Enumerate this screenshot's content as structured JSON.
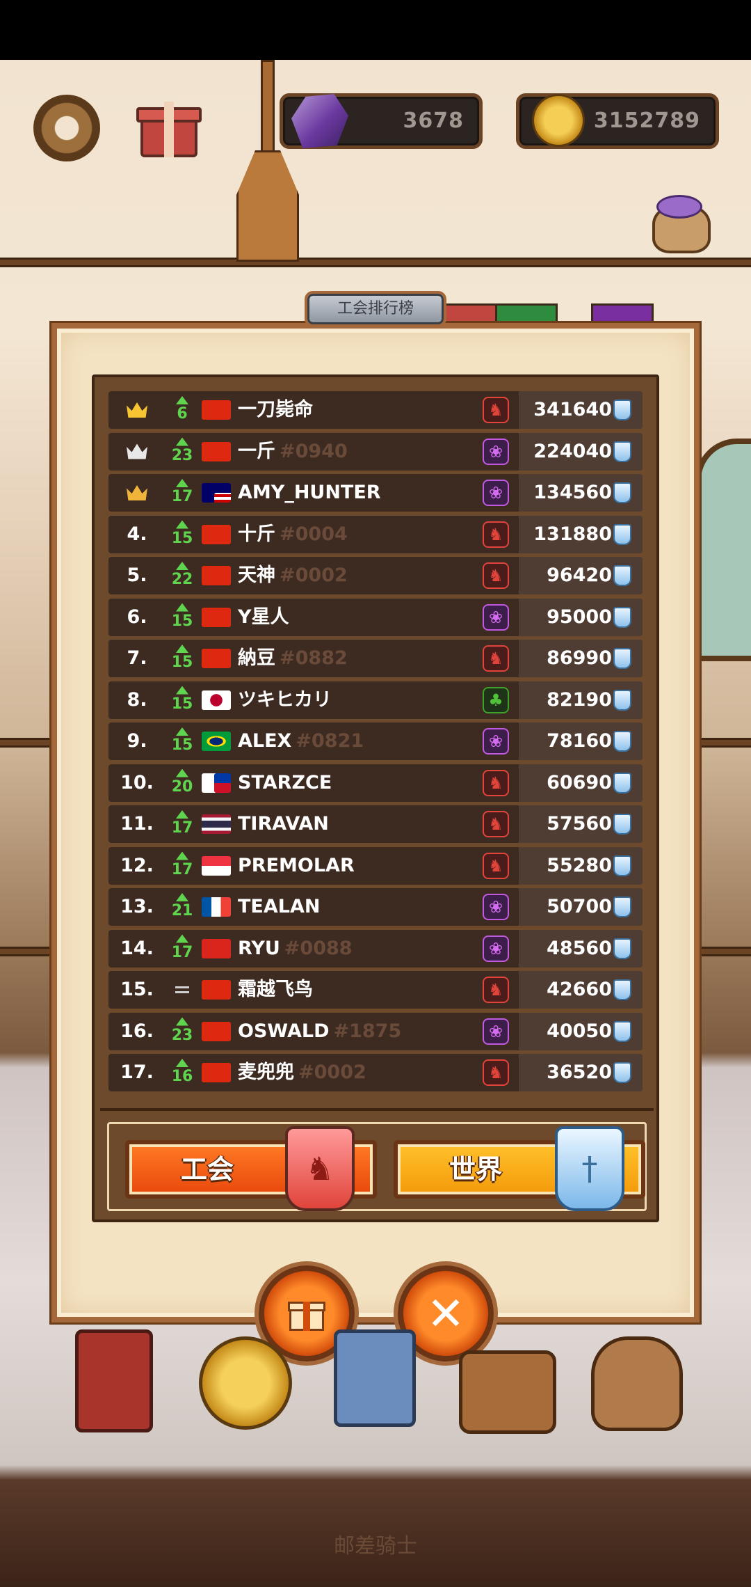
{
  "hud": {
    "gems": "3678",
    "coins": "3152789"
  },
  "panel": {
    "title": "工会排行榜"
  },
  "leaderboard": [
    {
      "rank": "",
      "crown": "gold",
      "level": "6",
      "trend": "up",
      "flag": "cn",
      "name": "一刀毙命",
      "tag": "",
      "guild": "red",
      "score": "341640"
    },
    {
      "rank": "",
      "crown": "silver",
      "level": "23",
      "trend": "up",
      "flag": "cn",
      "name": "一斤",
      "tag": "#0940",
      "guild": "purple",
      "score": "224040"
    },
    {
      "rank": "",
      "crown": "bronze",
      "level": "17",
      "trend": "up",
      "flag": "my",
      "name": "AMY_HUNTER",
      "tag": "",
      "guild": "purple",
      "score": "134560"
    },
    {
      "rank": "4.",
      "crown": "",
      "level": "15",
      "trend": "up",
      "flag": "cn",
      "name": "十斤",
      "tag": "#0004",
      "guild": "red",
      "score": "131880"
    },
    {
      "rank": "5.",
      "crown": "",
      "level": "22",
      "trend": "up",
      "flag": "cn",
      "name": "天神",
      "tag": "#0002",
      "guild": "red",
      "score": "96420"
    },
    {
      "rank": "6.",
      "crown": "",
      "level": "15",
      "trend": "up",
      "flag": "cn",
      "name": "Y星人",
      "tag": "",
      "guild": "purple",
      "score": "95000"
    },
    {
      "rank": "7.",
      "crown": "",
      "level": "15",
      "trend": "up",
      "flag": "cn",
      "name": "納豆",
      "tag": "#0882",
      "guild": "red",
      "score": "86990"
    },
    {
      "rank": "8.",
      "crown": "",
      "level": "15",
      "trend": "up",
      "flag": "jp",
      "name": "ツキヒカリ",
      "tag": "",
      "guild": "green",
      "score": "82190"
    },
    {
      "rank": "9.",
      "crown": "",
      "level": "15",
      "trend": "up",
      "flag": "br",
      "name": "ALEX",
      "tag": "#0821",
      "guild": "purple",
      "score": "78160"
    },
    {
      "rank": "10.",
      "crown": "",
      "level": "20",
      "trend": "up",
      "flag": "ph",
      "name": "STARZCE",
      "tag": "",
      "guild": "red",
      "score": "60690"
    },
    {
      "rank": "11.",
      "crown": "",
      "level": "17",
      "trend": "up",
      "flag": "th",
      "name": "TIRAVAN",
      "tag": "",
      "guild": "red",
      "score": "57560"
    },
    {
      "rank": "12.",
      "crown": "",
      "level": "17",
      "trend": "up",
      "flag": "sg",
      "name": "PREMOLAR",
      "tag": "",
      "guild": "red",
      "score": "55280"
    },
    {
      "rank": "13.",
      "crown": "",
      "level": "21",
      "trend": "up",
      "flag": "fr",
      "name": "TEALAN",
      "tag": "",
      "guild": "purple",
      "score": "50700"
    },
    {
      "rank": "14.",
      "crown": "",
      "level": "17",
      "trend": "up",
      "flag": "vn",
      "name": "RYU",
      "tag": "#0088",
      "guild": "purple",
      "score": "48560"
    },
    {
      "rank": "15.",
      "crown": "",
      "level": "",
      "trend": "same",
      "flag": "cn",
      "name": "霜越飞鸟",
      "tag": "",
      "guild": "red",
      "score": "42660"
    },
    {
      "rank": "16.",
      "crown": "",
      "level": "23",
      "trend": "up",
      "flag": "cn",
      "name": "OSWALD",
      "tag": "#1875",
      "guild": "purple",
      "score": "40050"
    },
    {
      "rank": "17.",
      "crown": "",
      "level": "16",
      "trend": "up",
      "flag": "cn",
      "name": "麦兜兜",
      "tag": "#0002",
      "guild": "red",
      "score": "36520"
    }
  ],
  "tabs": {
    "guild_label": "工会",
    "world_label": "世界"
  },
  "footer": {
    "watermark": "邮差骑士"
  },
  "colors": {
    "accent_orange": "#e9480b",
    "accent_yellow": "#f39a0a",
    "level_green": "#5fd44f",
    "row_bg": "#3d2b22"
  },
  "icons": {
    "settings": "gear-icon",
    "gift": "gift-icon",
    "gem": "gem-icon",
    "coin": "coin-icon",
    "score": "shield-icon",
    "close": "close-icon"
  }
}
